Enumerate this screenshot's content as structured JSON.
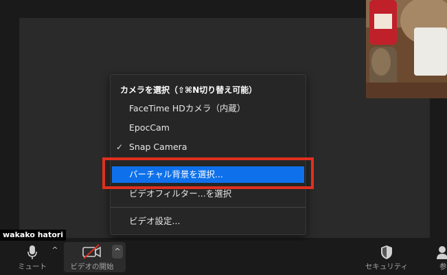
{
  "participant": {
    "name": "wakako hatori"
  },
  "camera_menu": {
    "header": "カメラを選択（⇧⌘N切り替え可能）",
    "items": [
      {
        "label": "FaceTime HDカメラ（内蔵）",
        "checked": false
      },
      {
        "label": "EpocCam",
        "checked": false
      },
      {
        "label": "Snap Camera",
        "checked": true
      }
    ],
    "check_glyph": "✓",
    "virtual_bg": "バーチャル背景を選択...",
    "video_filter": "ビデオフィルター...を選択",
    "video_settings": "ビデオ設定..."
  },
  "toolbar": {
    "mute_label": "ミュート",
    "start_video_label": "ビデオの開始",
    "security_label": "セキュリティ",
    "participants_label": "参",
    "caret_glyph": "^"
  },
  "colors": {
    "menu_selected": "#0e71eb",
    "highlight_box": "#e0301e",
    "video_off_slash": "#e0301e"
  }
}
